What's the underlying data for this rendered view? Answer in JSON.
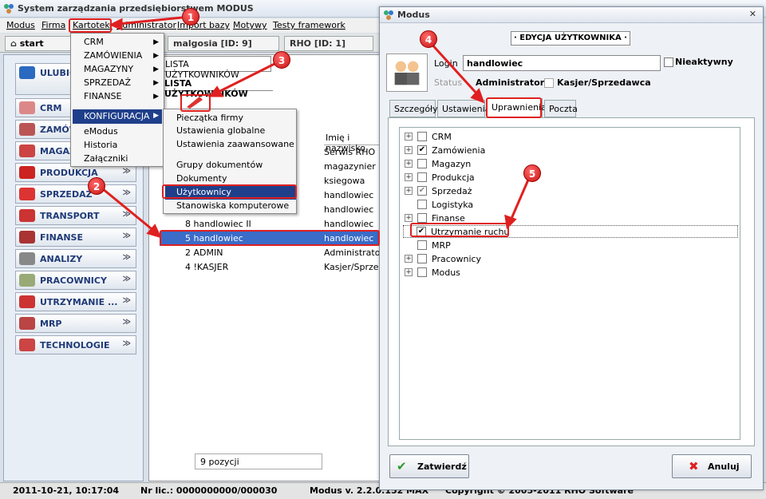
{
  "app": {
    "title": "System zarządzania przedsiębiorstwem MODUS"
  },
  "menu": [
    "Modus",
    "Firma",
    "Kartoteki",
    "Administrator",
    "Import bazy",
    "Motywy",
    "Testy framework"
  ],
  "tabs": {
    "start": "start",
    "user": "malgosia [ID: 9]",
    "company": "RHO [ID: 1]"
  },
  "sidebar": [
    "ULUBIONE",
    "CRM",
    "ZAMÓWIENIA",
    "MAGAZYN",
    "PRODUKCJA",
    "SPRZEDAŻ",
    "TRANSPORT",
    "FINANSE",
    "ANALIZY",
    "PRACOWNICY",
    "UTRZYMANIE ...",
    "MRP",
    "TECHNOLOGIE"
  ],
  "kartoteki_menu": [
    "CRM",
    "ZAMÓWIENIA",
    "MAGAZYNY",
    "SPRZEDAŻ",
    "FINANSE",
    "KONFIGURACJA",
    "eModus",
    "Historia",
    "Załączniki"
  ],
  "konfiguracja_menu": [
    "Pieczątka firmy",
    "Ustawienia globalne",
    "Ustawienia zaawansowane",
    "Grupy dokumentów",
    "Dokumenty",
    "Użytkownicy",
    "Stanowiska komputerowe"
  ],
  "list": {
    "tab": "LISTA UŻYTKOWNIKÓW",
    "header": "LISTA UŻYTKOWNIKÓW",
    "col_name": "Imię i nazwisko",
    "rows": [
      [
        "",
        "Serwis RHO"
      ],
      [
        "",
        "magazynier"
      ],
      [
        "",
        "ksiegowa"
      ],
      [
        "",
        "handlowiec"
      ],
      [
        "",
        "handlowiec"
      ],
      [
        "8 handlowiec II",
        "handlowiec"
      ],
      [
        "5 handlowiec",
        "handlowiec"
      ],
      [
        "2 ADMIN",
        "Administrator s"
      ],
      [
        "4 !KASJER",
        "Kasjer/Sprzed"
      ]
    ],
    "count": "9 pozycji"
  },
  "dialog": {
    "title": "Modus",
    "header": "· EDYCJA UŻYTKOWNIKA ·",
    "login_label": "Login",
    "login_value": "handlowiec",
    "inactive": "Nieaktywny",
    "status_label": "Status",
    "status_admin": "Administrator",
    "status_cashier": "Kasjer/Sprzedawca",
    "tabs": [
      "Szczegóły",
      "Ustawienia",
      "Uprawnienia",
      "Poczta"
    ],
    "tree": [
      [
        "CRM",
        false
      ],
      [
        "Zamówienia",
        true
      ],
      [
        "Magazyn",
        false
      ],
      [
        "Produkcja",
        false
      ],
      [
        "Sprzedaż",
        true
      ],
      [
        "Logistyka",
        false
      ],
      [
        "Finanse",
        false
      ],
      [
        "Utrzymanie ruchu",
        true
      ],
      [
        "MRP",
        false
      ],
      [
        "Pracownicy",
        false
      ],
      [
        "Modus",
        false
      ]
    ],
    "ok": "Zatwierdź",
    "cancel": "Anuluj"
  },
  "statusbar": {
    "date": "2011-10-21,  10:17:04",
    "license": "Nr lic.: 0000000000/000030",
    "version": "Modus v. 2.2.0.152 MAX",
    "copyright": "Copyright © 2005-2011 RHO Software"
  },
  "badges": [
    "1",
    "2",
    "3",
    "4",
    "5"
  ]
}
